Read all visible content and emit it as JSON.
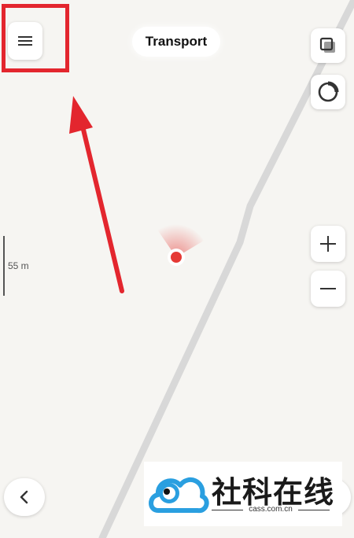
{
  "header": {
    "title": "Transport"
  },
  "scale": {
    "label": "55 m"
  },
  "icons": {
    "menu": "hamburger-menu-icon",
    "layers": "layers-icon",
    "compass": "compass-icon",
    "zoom_in": "plus-icon",
    "zoom_out": "minus-icon",
    "back": "chevron-left-icon"
  },
  "controls": {
    "zoom_in_label": "+",
    "zoom_out_label": "−"
  },
  "watermark": {
    "name": "社科在线",
    "domain": "cass.com.cn"
  },
  "colors": {
    "highlight": "#e3262e",
    "location_dot": "#e53935",
    "map_bg": "#f6f5f2",
    "road": "#d8d8d8"
  }
}
